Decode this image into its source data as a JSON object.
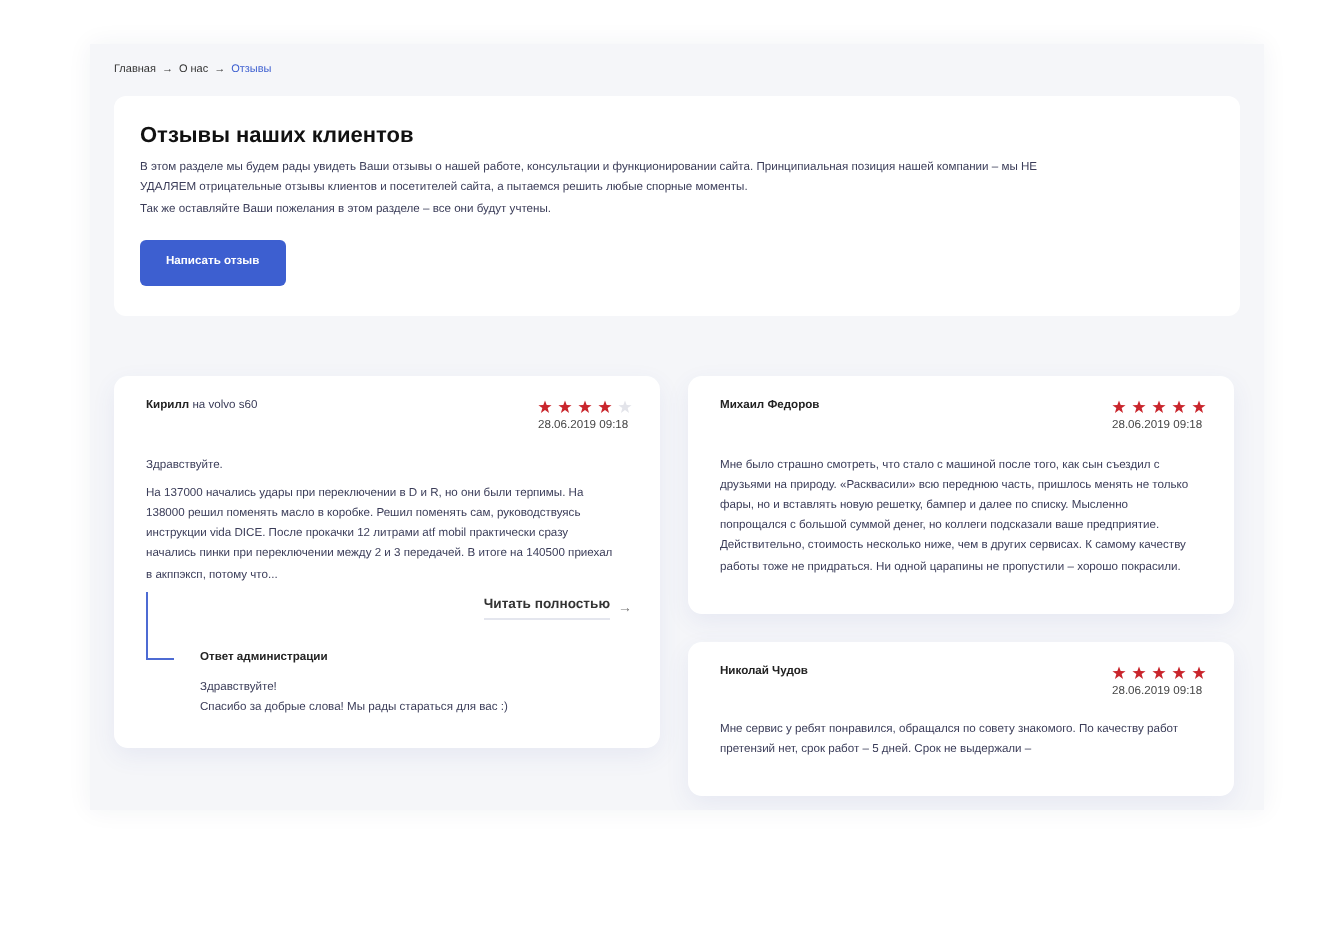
{
  "breadcrumb": [
    {
      "kind": "link",
      "text": "Главная"
    },
    {
      "kind": "separator",
      "text": "→"
    },
    {
      "kind": "link",
      "text": "О нас"
    },
    {
      "kind": "separator",
      "text": "→"
    },
    {
      "kind": "current",
      "text": "Отзывы"
    }
  ],
  "intro": {
    "title": "Отзывы наших клиентов",
    "paragraphs": [
      "В этом разделе мы будем рады увидеть Ваши отзывы о нашей работе, консультации и функционировании сайта. Принципиальная позиция нашей компании – мы НЕ УДАЛЯЕМ отрицательные отзывы клиентов и посетителей сайта, а пытаемся решить любые спорные моменты.",
      "Так же оставляйте Ваши пожелания в этом разделе – все они будут учтены."
    ],
    "button": "Написать отзыв"
  },
  "reviews": [
    {
      "author": "Кирилл",
      "car": "на volvo s60",
      "stars": 4,
      "date": "28.06.2019 09:18",
      "paragraphs": [
        "Здравствуйте.",
        "На 137000 начались удары при переключении в D и R, но они были терпимы. На 138000 решил поменять масло в коробке. Решил поменять сам, руководствуясь инструкции vida DICE. После прокачки 12 литрами atf mobil практически сразу начались пинки при переключении между 2 и 3 передачей. В итоге на 140500 приехал в акппэксп, потому что..."
      ],
      "read_more": "Читать полностью",
      "read_more_arrow": "→",
      "reply": {
        "title": "Ответ администрации",
        "lines": [
          "Здравствуйте!",
          "Спасибо за добрые слова! Мы рады стараться для вас :)"
        ]
      }
    },
    {
      "author": "Михаил Федоров",
      "stars": 5,
      "date": "28.06.2019 09:18",
      "paragraphs": [
        "Мне было страшно смотреть, что стало с машиной после того, как сын съездил с друзьями на природу. «Расквасили» всю переднюю часть, пришлось менять не только фары, но и вставлять новую решетку, бампер и далее по списку. Мысленно попрощался с большой суммой денег, но коллеги подсказали ваше предприятие. Действительно, стоимость несколько ниже, чем в других сервисах. К самому качеству работы тоже не придраться. Ни одной царапины не пропустили – хорошо покрасили."
      ]
    },
    {
      "author": "Николай Чудов",
      "stars": 5,
      "date": "28.06.2019 09:18",
      "paragraphs": [
        "Мне сервис у ребят понравился, обращался по совету знакомого. По качеству работ претензий нет, срок работ – 5 дней. Срок не выдержали –"
      ]
    }
  ]
}
